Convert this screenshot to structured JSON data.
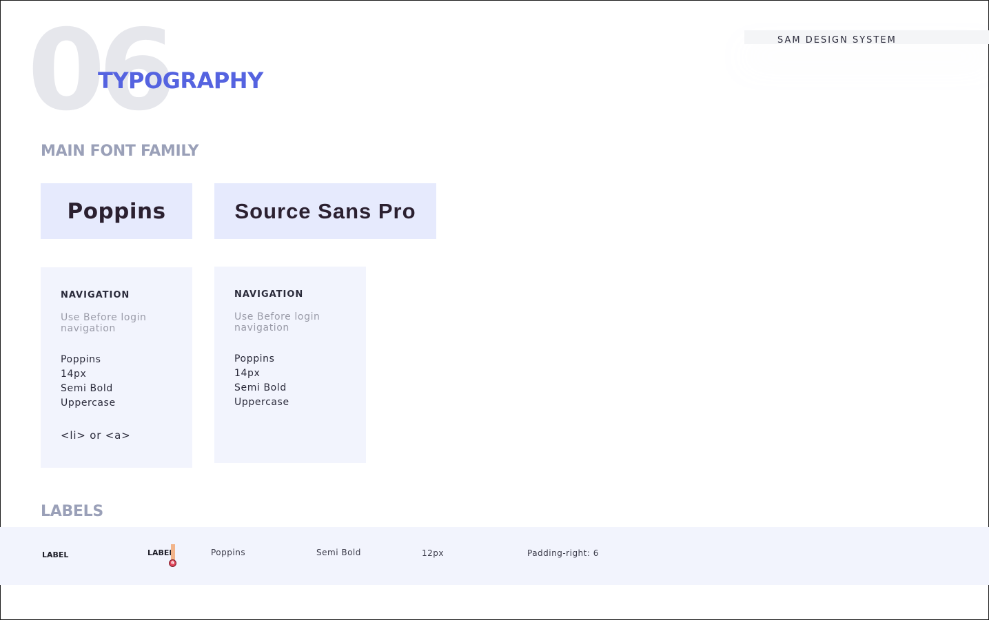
{
  "page": {
    "number": "06",
    "title": "TYPOGRAPHY",
    "brand": "SAM DESIGN SYSTEM"
  },
  "sections": {
    "main_font_family": "MAIN FONT FAMILY",
    "labels": "LABELS"
  },
  "font_families": [
    "Poppins",
    "Source Sans Pro"
  ],
  "cards": [
    {
      "title": "NAVIGATION",
      "description": "Use Before login navigation",
      "specs": [
        "Poppins",
        "14px",
        "Semi Bold",
        "Uppercase"
      ],
      "tags": "<li> or  <a>"
    },
    {
      "title": "NAVIGATION",
      "description": "Use Before login navigation",
      "specs": [
        "Poppins",
        "14px",
        "Semi Bold",
        "Uppercase"
      ]
    }
  ],
  "label_spec": {
    "sample": "LABEL",
    "annotated_sample": "LABEL",
    "padding_badge": "6",
    "font": "Poppins",
    "weight": "Semi Bold",
    "size": "12px",
    "padding": "Padding-right: 6"
  },
  "colors": {
    "accent": "#5563e0",
    "heading_muted": "#9aa0b8",
    "chip_background": "#e6eafd",
    "card_background": "#f2f4fd",
    "padding_marker": "#f2b48a",
    "padding_badge": "#e0455a"
  }
}
